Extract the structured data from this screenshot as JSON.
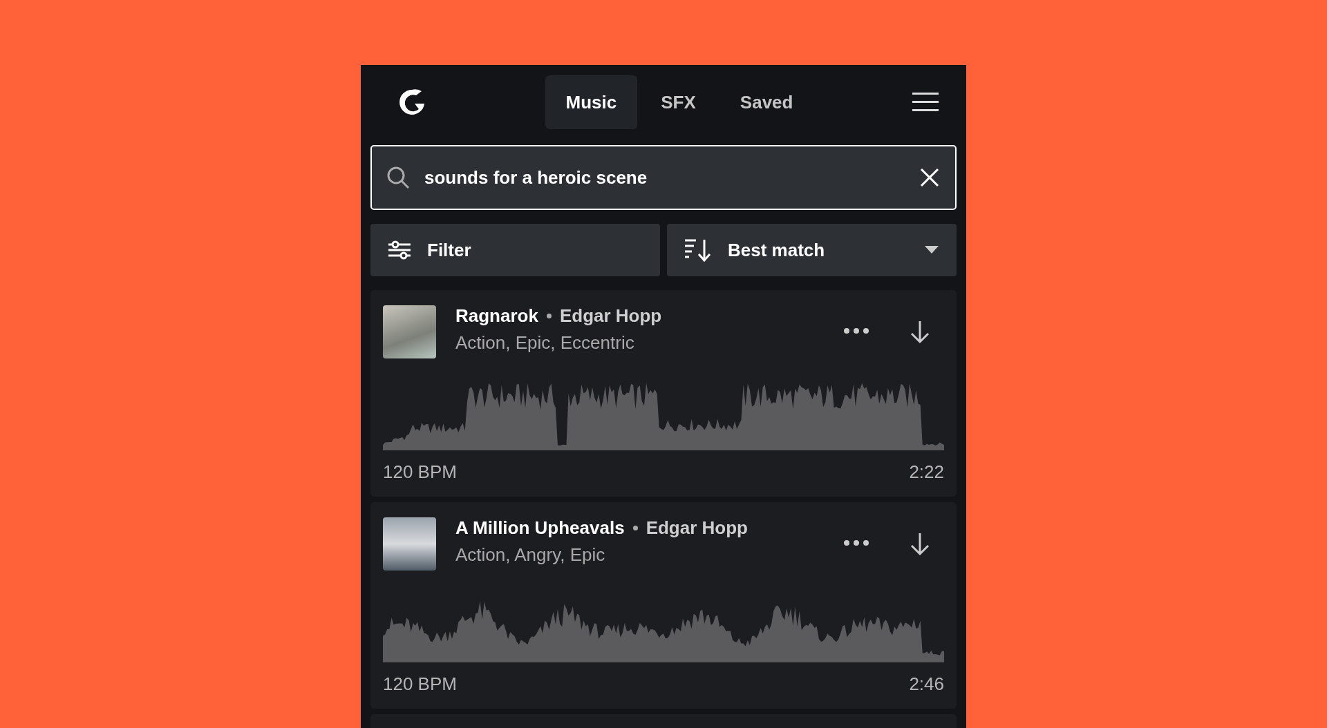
{
  "header": {
    "tabs": [
      {
        "label": "Music",
        "selected": true
      },
      {
        "label": "SFX",
        "selected": false
      },
      {
        "label": "Saved",
        "selected": false
      }
    ]
  },
  "search": {
    "value": "sounds for a heroic scene"
  },
  "filter_button": {
    "label": "Filter"
  },
  "sort_dropdown": {
    "label": "Best match"
  },
  "tracks": [
    {
      "title": "Ragnarok",
      "artist": "Edgar Hopp",
      "tags": "Action, Epic, Eccentric",
      "bpm": "120 BPM",
      "duration": "2:22"
    },
    {
      "title": "A Million Upheavals",
      "artist": "Edgar Hopp",
      "tags": "Action, Angry, Epic",
      "bpm": "120 BPM",
      "duration": "2:46"
    }
  ]
}
